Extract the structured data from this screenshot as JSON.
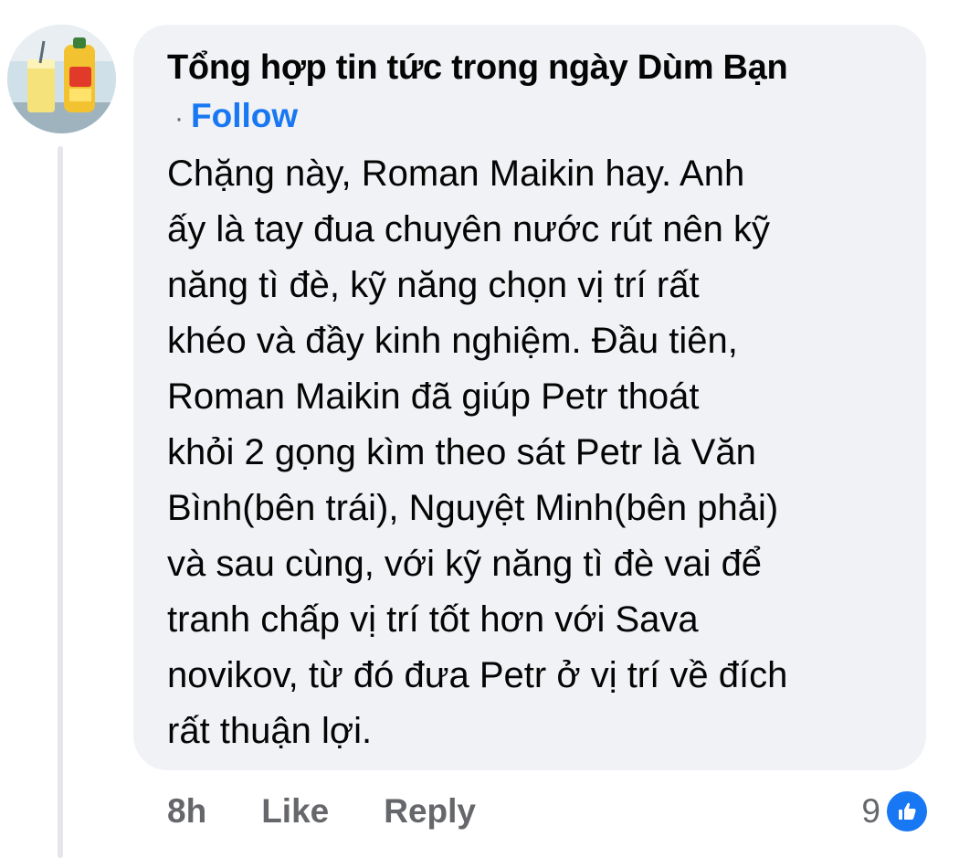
{
  "comment": {
    "author": "Tổng hợp tin tức trong ngày Dùm Bạn",
    "separator": "·",
    "follow_label": "Follow",
    "text": "Chặng này, Roman Maikin hay. Anh\nấy là tay đua chuyên nước rút nên kỹ\nnăng tì đè, kỹ năng chọn vị trí rất\nkhéo và đầy kinh nghiệm. Đầu tiên,\nRoman Maikin đã giúp Petr thoát\nkhỏi 2 gọng kìm theo sát Petr là Văn\nBình(bên trái), Nguyệt Minh(bên phải)\nvà sau cùng, với kỹ năng tì đè vai để\ntranh chấp vị trí tốt hơn với Sava\nnovikov, từ đó đưa Petr ở vị trí về đích\nrất thuận lợi.",
    "time": "8h",
    "like_label": "Like",
    "reply_label": "Reply",
    "reaction_count": "9",
    "reaction_icon": "thumbs-up-icon",
    "accent_color": "#1877f2"
  }
}
